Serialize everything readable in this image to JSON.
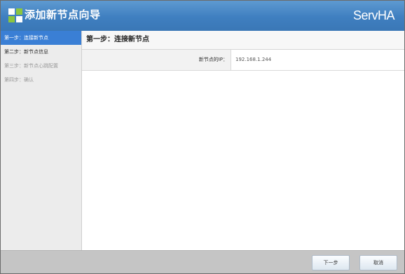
{
  "header": {
    "title": "添加新节点向导",
    "brand": "ServHA",
    "colors": {
      "bar": "#3f7fc0",
      "logo_green": "#8cc63f",
      "logo_white": "#ffffff"
    },
    "logo_icon": "grid-squares-icon"
  },
  "sidebar": {
    "active_color": "#3a7fd5",
    "steps": [
      {
        "label": "第一步：连接新节点",
        "state": "active"
      },
      {
        "label": "第二步：新节点信息",
        "state": "normal"
      },
      {
        "label": "第三步：新节点心跳配置",
        "state": "disabled"
      },
      {
        "label": "第四步：确认",
        "state": "disabled"
      }
    ]
  },
  "main": {
    "title": "第一步：连接新节点",
    "ip_label": "新节点的IP：",
    "ip_value": "192.168.1.244"
  },
  "footer": {
    "next_label": "下一步",
    "cancel_label": "取消"
  }
}
